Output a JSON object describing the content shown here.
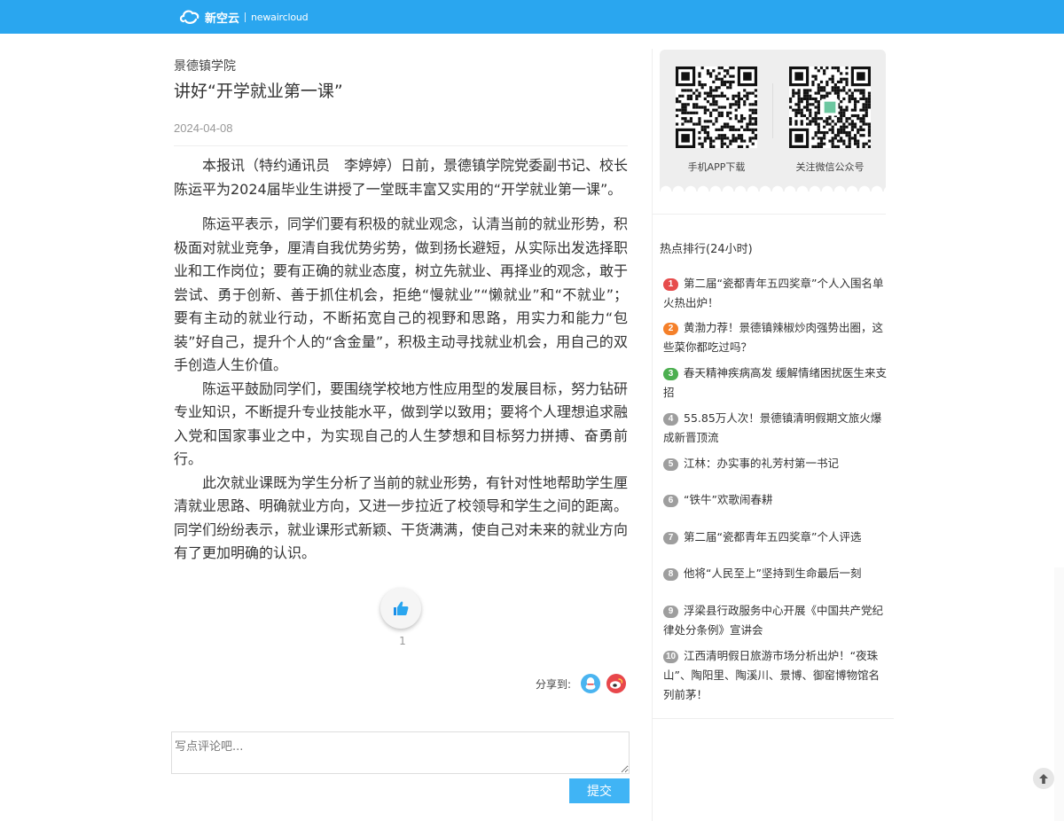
{
  "header": {
    "logo_cn": "新空云",
    "logo_en": "newaircloud",
    "bar_color": "#2aa6ef"
  },
  "article": {
    "source": "景德镇学院",
    "title": "讲好“开学就业第一课”",
    "date": "2024-04-08",
    "paragraphs": [
      "本报讯（特约通讯员　李婷婷）日前，景德镇学院党委副书记、校长陈运平为2024届毕业生讲授了一堂既丰富又实用的“开学就业第一课”。",
      "陈运平表示，同学们要有积极的就业观念，认清当前的就业形势，积极面对就业竞争，厘清自我优势劣势，做到扬长避短，从实际出发选择职业和工作岗位；要有正确的就业态度，树立先就业、再择业的观念，敢于尝试、勇于创新、善于抓住机会，拒绝“慢就业”“懒就业”和“不就业”；要有主动的就业行动，不断拓宽自己的视野和思路，用实力和能力“包装”好自己，提升个人的“含金量”，积极主动寻找就业机会，用自己的双手创造人生价值。",
      "陈运平鼓励同学们，要围绕学校地方性应用型的发展目标，努力钻研专业知识，不断提升专业技能水平，做到学以致用；要将个人理想追求融入党和国家事业之中，为实现自己的人生梦想和目标努力拼搏、奋勇前行。",
      "此次就业课既为学生分析了当前的就业形势，有针对性地帮助学生厘清就业思路、明确就业方向，又进一步拉近了校领导和学生之间的距离。同学们纷纷表示，就业课形式新颖、干货满满，使自己对未来的就业方向有了更加明确的认识。"
    ],
    "like_count": "1",
    "share_label": "分享到:",
    "share_icons": [
      "qq-icon",
      "weibo-icon"
    ]
  },
  "comment": {
    "placeholder": "写点评论吧...",
    "submit_label": "提交"
  },
  "sidebar": {
    "qr_codes": [
      {
        "label": "手机APP下载"
      },
      {
        "label": "关注微信公众号"
      }
    ],
    "hot_title": "热点排行(24小时)",
    "hot_items": [
      {
        "rank": "1",
        "text": "第二届“瓷都青年五四奖章”个人入围名单火热出炉！",
        "color": "#e64c4c"
      },
      {
        "rank": "2",
        "text": "黄渤力荐！景德镇辣椒炒肉强势出圈，这些菜你都吃过吗？",
        "color": "#f5802a"
      },
      {
        "rank": "3",
        "text": "春天精神疾病高发 缓解情绪困扰医生来支招",
        "color": "#4caf50"
      },
      {
        "rank": "4",
        "text": "55.85万人次！景德镇清明假期文旅火爆成新晋顶流",
        "color": "#9e9e9e"
      },
      {
        "rank": "5",
        "text": "江林：办实事的礼芳村第一书记",
        "color": "#9e9e9e"
      },
      {
        "rank": "6",
        "text": "“铁牛”欢歌闹春耕",
        "color": "#9e9e9e"
      },
      {
        "rank": "7",
        "text": "第二届“瓷都青年五四奖章”个人评选",
        "color": "#9e9e9e"
      },
      {
        "rank": "8",
        "text": "他将“人民至上”坚持到生命最后一刻",
        "color": "#9e9e9e"
      },
      {
        "rank": "9",
        "text": "浮梁县行政服务中心开展《中国共产党纪律处分条例》宣讲会",
        "color": "#9e9e9e"
      },
      {
        "rank": "10",
        "text": "江西清明假日旅游市场分析出炉！“夜珠山”、陶阳里、陶溪川、景博、御窑博物馆名列前茅！",
        "color": "#9e9e9e"
      }
    ]
  }
}
